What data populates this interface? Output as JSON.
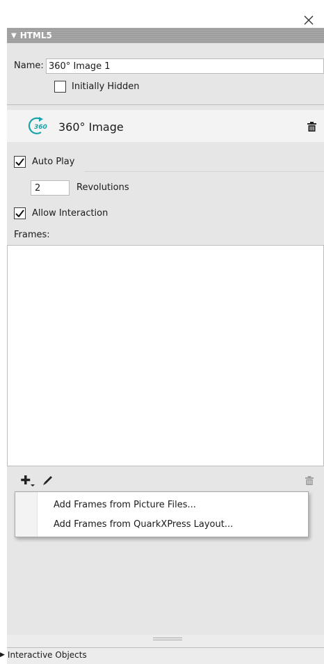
{
  "window": {
    "close_icon": "close-icon"
  },
  "section": {
    "title": "HTML5",
    "name_label": "Name:",
    "name_value": "360° Image 1",
    "initially_hidden_label": "Initially Hidden",
    "initially_hidden_checked": false
  },
  "widget": {
    "badge": "360",
    "title": "360° Image",
    "icon": "360-rotate-icon",
    "delete_icon": "trash-icon"
  },
  "options": {
    "auto_play_label": "Auto Play",
    "auto_play_checked": true,
    "revolutions_value": "2",
    "revolutions_label": "Revolutions",
    "allow_interaction_label": "Allow Interaction",
    "allow_interaction_checked": true,
    "frames_label": "Frames:"
  },
  "frames_toolbar": {
    "add_icon": "plus-icon",
    "edit_icon": "pencil-icon",
    "delete_icon": "trash-icon"
  },
  "add_menu": {
    "items": [
      {
        "label": "Add Frames from Picture Files..."
      },
      {
        "label": "Add Frames from QuarkXPress Layout..."
      }
    ]
  },
  "footer": {
    "label": "Interactive Objects"
  },
  "colors": {
    "accent": "#1aa3a8",
    "header": "#9e9e9e",
    "panel": "#e6e6e6"
  }
}
